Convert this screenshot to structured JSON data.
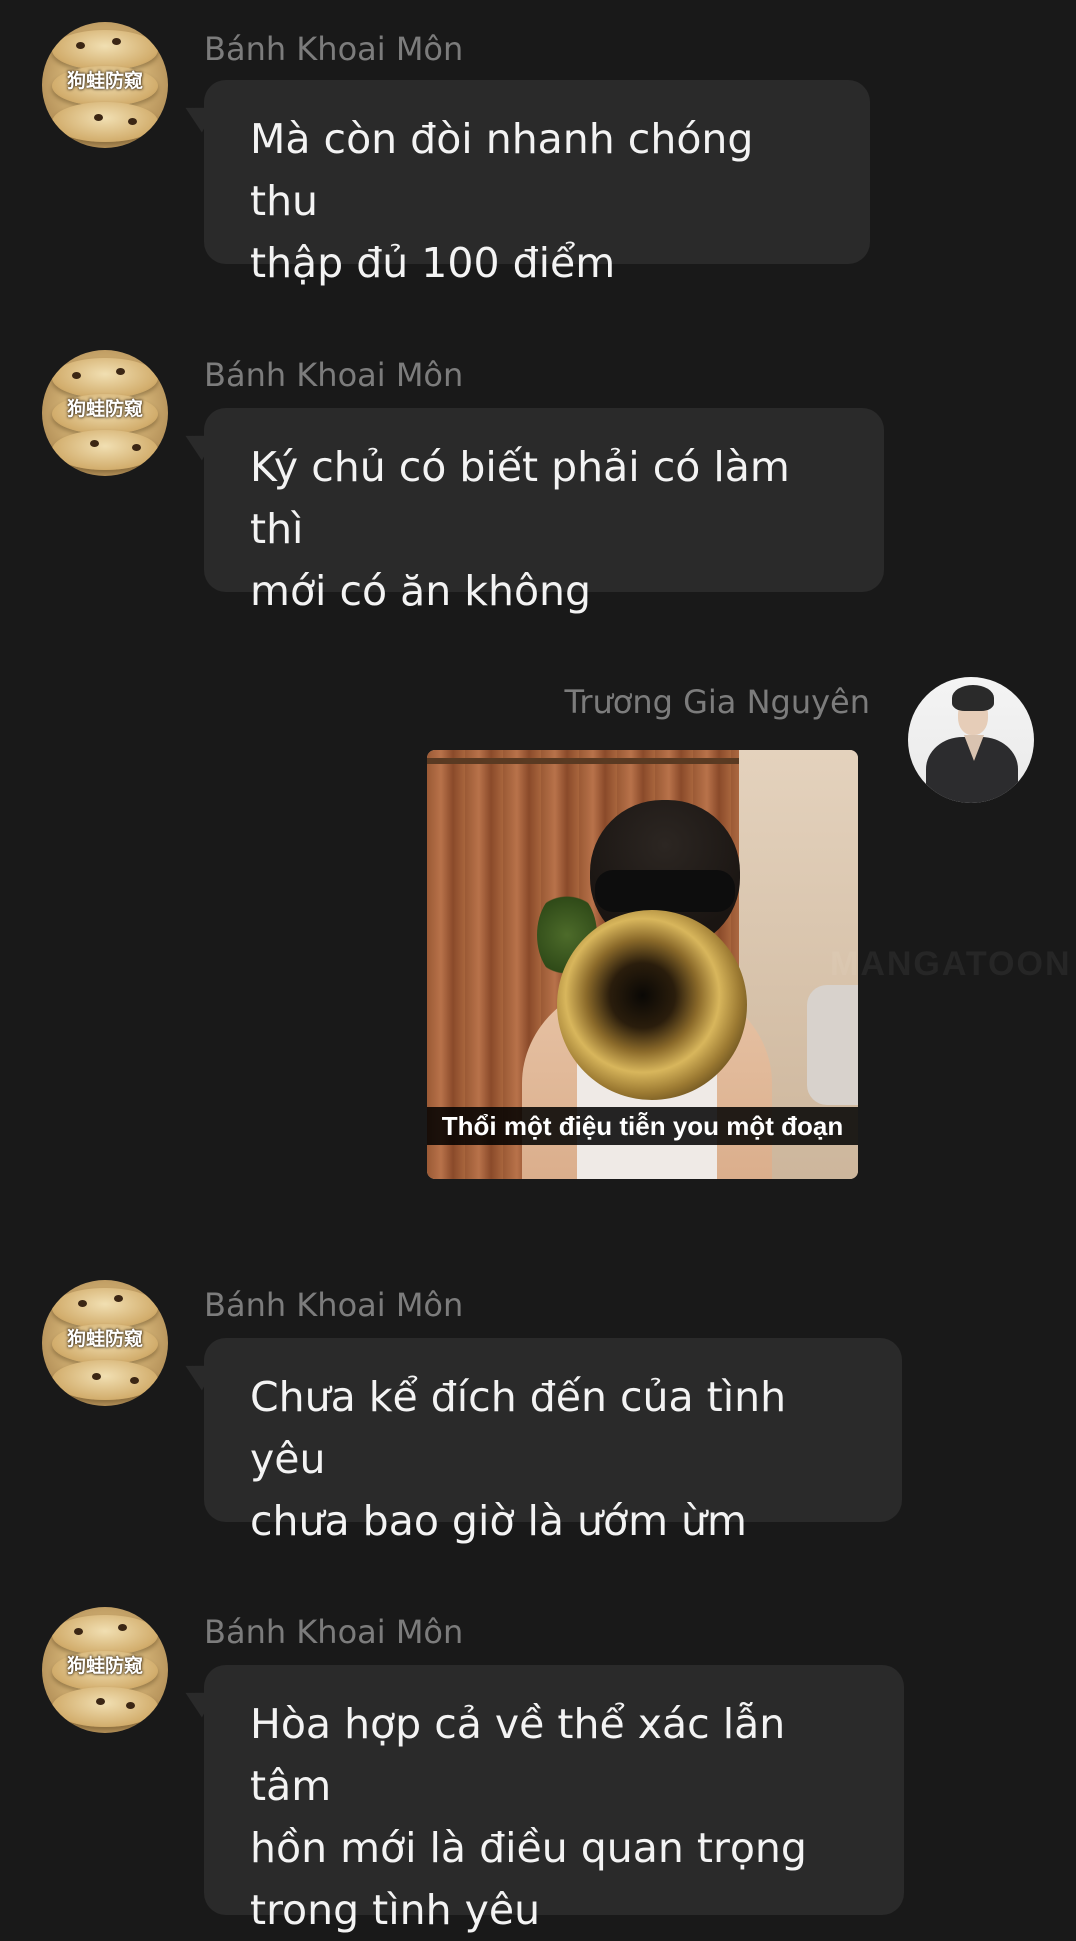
{
  "messages": [
    {
      "sender": "Bánh Khoai Môn",
      "avatar_stamp": "狗蛙防窥",
      "text_lines": [
        "Mà còn đòi nhanh chóng thu",
        "thập đủ 100 điểm"
      ]
    },
    {
      "sender": "Bánh Khoai Môn",
      "avatar_stamp": "狗蛙防窥",
      "text_lines": [
        "Ký chủ có biết phải có làm thì",
        "mới có ăn không"
      ]
    },
    {
      "sender": "Trương Gia Nguyên",
      "image_caption": "Thổi một điệu tiễn you một đoạn",
      "image_icon": "trumpet-meme-image"
    },
    {
      "sender": "Bánh Khoai Môn",
      "avatar_stamp": "狗蛙防窥",
      "text_lines": [
        "Chưa kể đích đến của tình yêu",
        "chưa bao giờ là ướm ừm"
      ]
    },
    {
      "sender": "Bánh Khoai Môn",
      "avatar_stamp": "狗蛙防窥",
      "text_lines": [
        "Hòa hợp cả về thể xác lẫn tâm",
        "hồn mới là điều quan trọng",
        "trong tình yêu"
      ]
    }
  ],
  "watermark": "MANGATOON",
  "colors": {
    "background": "#191919",
    "bubble": "#2a2a2a",
    "sender_name": "#7c7c7c",
    "message_text": "#f3f3f3"
  }
}
